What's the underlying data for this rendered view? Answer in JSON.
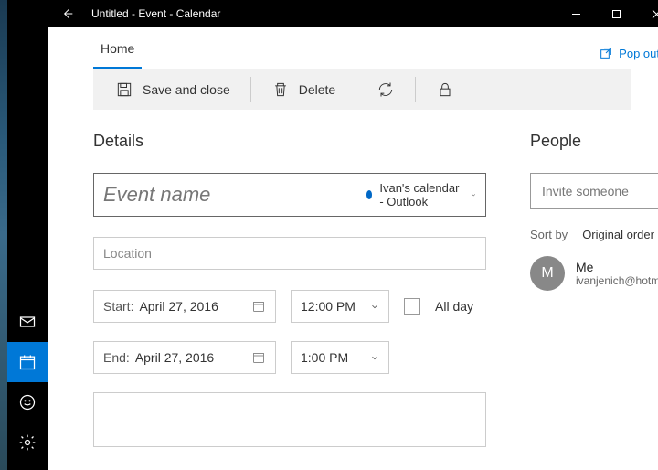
{
  "window": {
    "title": "Untitled - Event - Calendar"
  },
  "tabs": {
    "home": "Home",
    "popout": "Pop out"
  },
  "toolbar": {
    "save_close": "Save and close",
    "delete": "Delete"
  },
  "sections": {
    "details": "Details",
    "people": "People"
  },
  "event": {
    "name_placeholder": "Event name",
    "calendar_label": "Ivan's calendar - Outlook",
    "location_placeholder": "Location",
    "start_label": "Start:",
    "start_date": "April 27, 2016",
    "start_time": "12:00 PM",
    "end_label": "End:",
    "end_date": "April 27, 2016",
    "end_time": "1:00 PM",
    "all_day_label": "All day"
  },
  "people": {
    "invite_placeholder": "Invite someone",
    "sort_label": "Sort by",
    "sort_value": "Original order",
    "me": {
      "initial": "M",
      "name": "Me",
      "email": "ivanjenich@hotma"
    }
  }
}
